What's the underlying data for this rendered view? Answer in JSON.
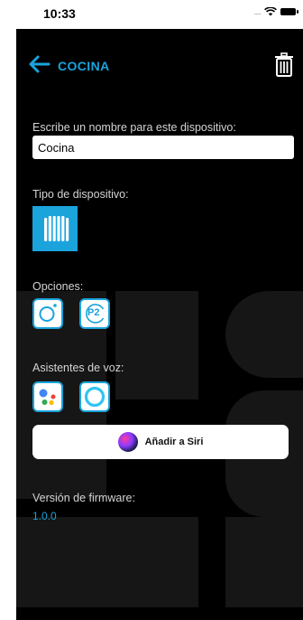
{
  "status_bar": {
    "time": "10:33",
    "signal": "....."
  },
  "header": {
    "title": "COCINA"
  },
  "form": {
    "name_label": "Escribe un nombre para este dispositivo:",
    "name_value": "Cocina",
    "device_type_label": "Tipo de dispositivo:",
    "options_label": "Opciones:",
    "option_p2_text": "P2",
    "voice_label": "Asistentes de voz:",
    "siri_button_label": "Añadir a Siri",
    "firmware_label": "Versión de firmware:",
    "firmware_value": "1.0.0"
  },
  "colors": {
    "accent": "#1aa3dc",
    "background": "#000000",
    "label": "#d4d4d4"
  },
  "icons": [
    "back-arrow-icon",
    "trash-icon",
    "radiator-icon",
    "circle-option-icon",
    "p2-option-icon",
    "google-assistant-icon",
    "alexa-icon",
    "siri-icon"
  ]
}
